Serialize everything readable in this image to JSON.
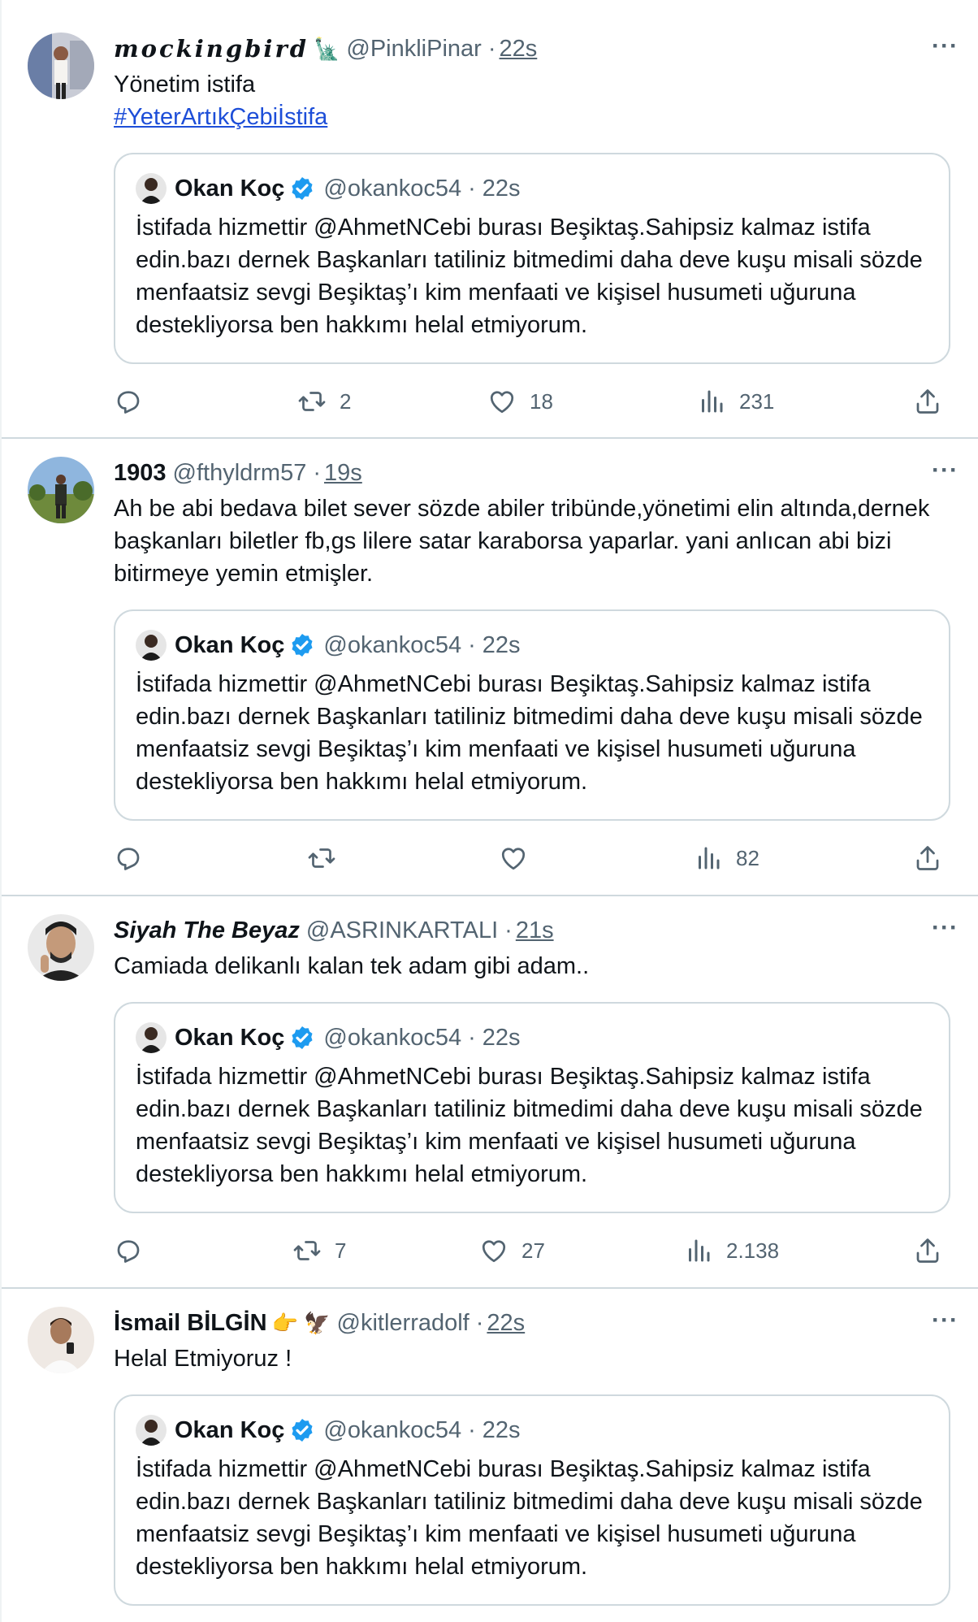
{
  "quoted": {
    "name": "Okan Koç",
    "handle": "@okankoc54",
    "time": "22s",
    "text": "İstifada hizmettir @AhmetNCebi burası Beşiktaş.Sahipsiz kalmaz istifa edin.bazı dernek Başkanları tatiliniz bitmedimi daha deve kuşu misali sözde menfaatsiz sevgi Beşiktaş’ı kim menfaati ve kişisel husumeti uğuruna destekliyorsa ben hakkımı helal etmiyorum."
  },
  "tweets": [
    {
      "name": "𝒎𝒐𝒄𝒌𝒊𝒏𝒈𝒃𝒊𝒓𝒅",
      "emoji": "🗽",
      "handle": "@PinkliPinar",
      "separator": "·",
      "time": "22s",
      "text": "Yönetim istifa",
      "hashtag": "#YeterArtıkÇebiİstifa",
      "replies": "",
      "retweets": "2",
      "likes": "18",
      "views": "231"
    },
    {
      "name": "1903",
      "handle": "@fthyldrm57",
      "separator": "·",
      "time": "19s",
      "text": "Ah be abi bedava bilet sever sözde abiler tribünde,yönetimi elin altında,dernek başkanları biletler fb,gs lilere satar karaborsa yaparlar. yani anlıcan abi bizi bitirmeye yemin etmişler.",
      "replies": "",
      "retweets": "",
      "likes": "",
      "views": "82"
    },
    {
      "name": "Siyah The Beyaz",
      "handle": "@ASRINKARTALI",
      "separator": "·",
      "time": "21s",
      "text": "Camiada delikanlı kalan tek adam gibi adam..",
      "replies": "",
      "retweets": "7",
      "likes": "27",
      "views": "2.138"
    },
    {
      "name": "İsmail BİLGİN",
      "emoji": "👉 🦅",
      "handle": "@kitlerradolf",
      "separator": "·",
      "time": "22s",
      "text": "Helal Etmiyoruz !"
    }
  ],
  "more_label": "···",
  "colors": {
    "text": "#0f1419",
    "secondary": "#536471",
    "link": "#1d4ed8",
    "verified": "#1d9bf0",
    "border": "#cfd9de"
  }
}
